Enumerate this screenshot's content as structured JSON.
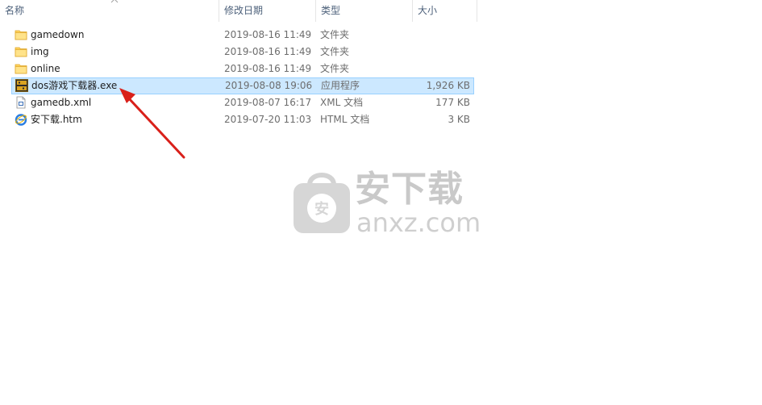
{
  "columns": {
    "name": "名称",
    "date": "修改日期",
    "type": "类型",
    "size": "大小"
  },
  "files": [
    {
      "name": "gamedown",
      "date": "2019-08-16 11:49",
      "type": "文件夹",
      "size": "",
      "icon": "folder-icon"
    },
    {
      "name": "img",
      "date": "2019-08-16 11:49",
      "type": "文件夹",
      "size": "",
      "icon": "folder-icon"
    },
    {
      "name": "online",
      "date": "2019-08-16 11:49",
      "type": "文件夹",
      "size": "",
      "icon": "folder-icon"
    },
    {
      "name": "dos游戏下载器.exe",
      "date": "2019-08-08 19:06",
      "type": "应用程序",
      "size": "1,926 KB",
      "icon": "dosbox-exe-icon",
      "selected": true
    },
    {
      "name": "gamedb.xml",
      "date": "2019-08-07 16:17",
      "type": "XML 文档",
      "size": "177 KB",
      "icon": "xml-file-icon"
    },
    {
      "name": "安下载.htm",
      "date": "2019-07-20 11:03",
      "type": "HTML 文档",
      "size": "3 KB",
      "icon": "ie-html-icon"
    }
  ],
  "watermark": {
    "cn": "安下载",
    "en": "anxz.com",
    "badge": "安"
  },
  "colors": {
    "selection_bg": "#cce8ff",
    "selection_border": "#99d1ff",
    "folder": "#ffd35c",
    "arrow": "#d9201a"
  }
}
